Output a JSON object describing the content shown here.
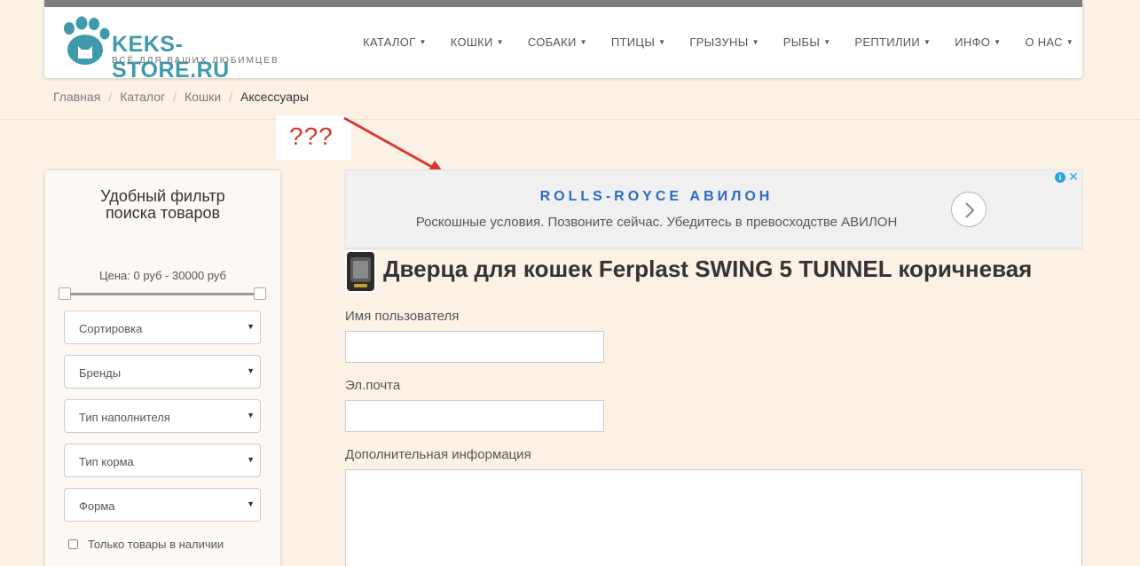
{
  "logo": {
    "name": "KEKS-STORE.RU",
    "tagline": "ВСЁ ДЛЯ ВАШИХ ЛЮБИМЦЕВ"
  },
  "nav": [
    "КАТАЛОГ",
    "КОШКИ",
    "СОБАКИ",
    "ПТИЦЫ",
    "ГРЫЗУНЫ",
    "РЫБЫ",
    "РЕПТИЛИИ",
    "ИНФО",
    "О НАС"
  ],
  "breadcrumb": [
    "Главная",
    "Каталог",
    "Кошки",
    "Аксессуары"
  ],
  "annotation": "???",
  "ad": {
    "title": "ROLLS-ROYCE АВИЛОН",
    "description": "Роскошные условия. Позвоните сейчас. Убедитесь в превосходстве АВИЛОН"
  },
  "filter": {
    "title_line1": "Удобный фильтр",
    "title_line2": "поиска товаров",
    "price": "Цена: 0 руб - 30000 руб",
    "selects": [
      "Сортировка",
      "Бренды",
      "Тип наполнителя",
      "Тип корма",
      "Форма"
    ],
    "in_stock": "Только товары в наличии"
  },
  "product": {
    "title": "Дверца для кошек Ferplast SWING 5 TUNNEL коричневая"
  },
  "form": {
    "username_label": "Имя пользователя",
    "email_label": "Эл.почта",
    "info_label": "Дополнительная информация"
  },
  "colors": {
    "accent": "#3f9aab",
    "background": "#fbf2e5",
    "ad_title": "#2a6ac8",
    "annotation": "#d9362f"
  }
}
